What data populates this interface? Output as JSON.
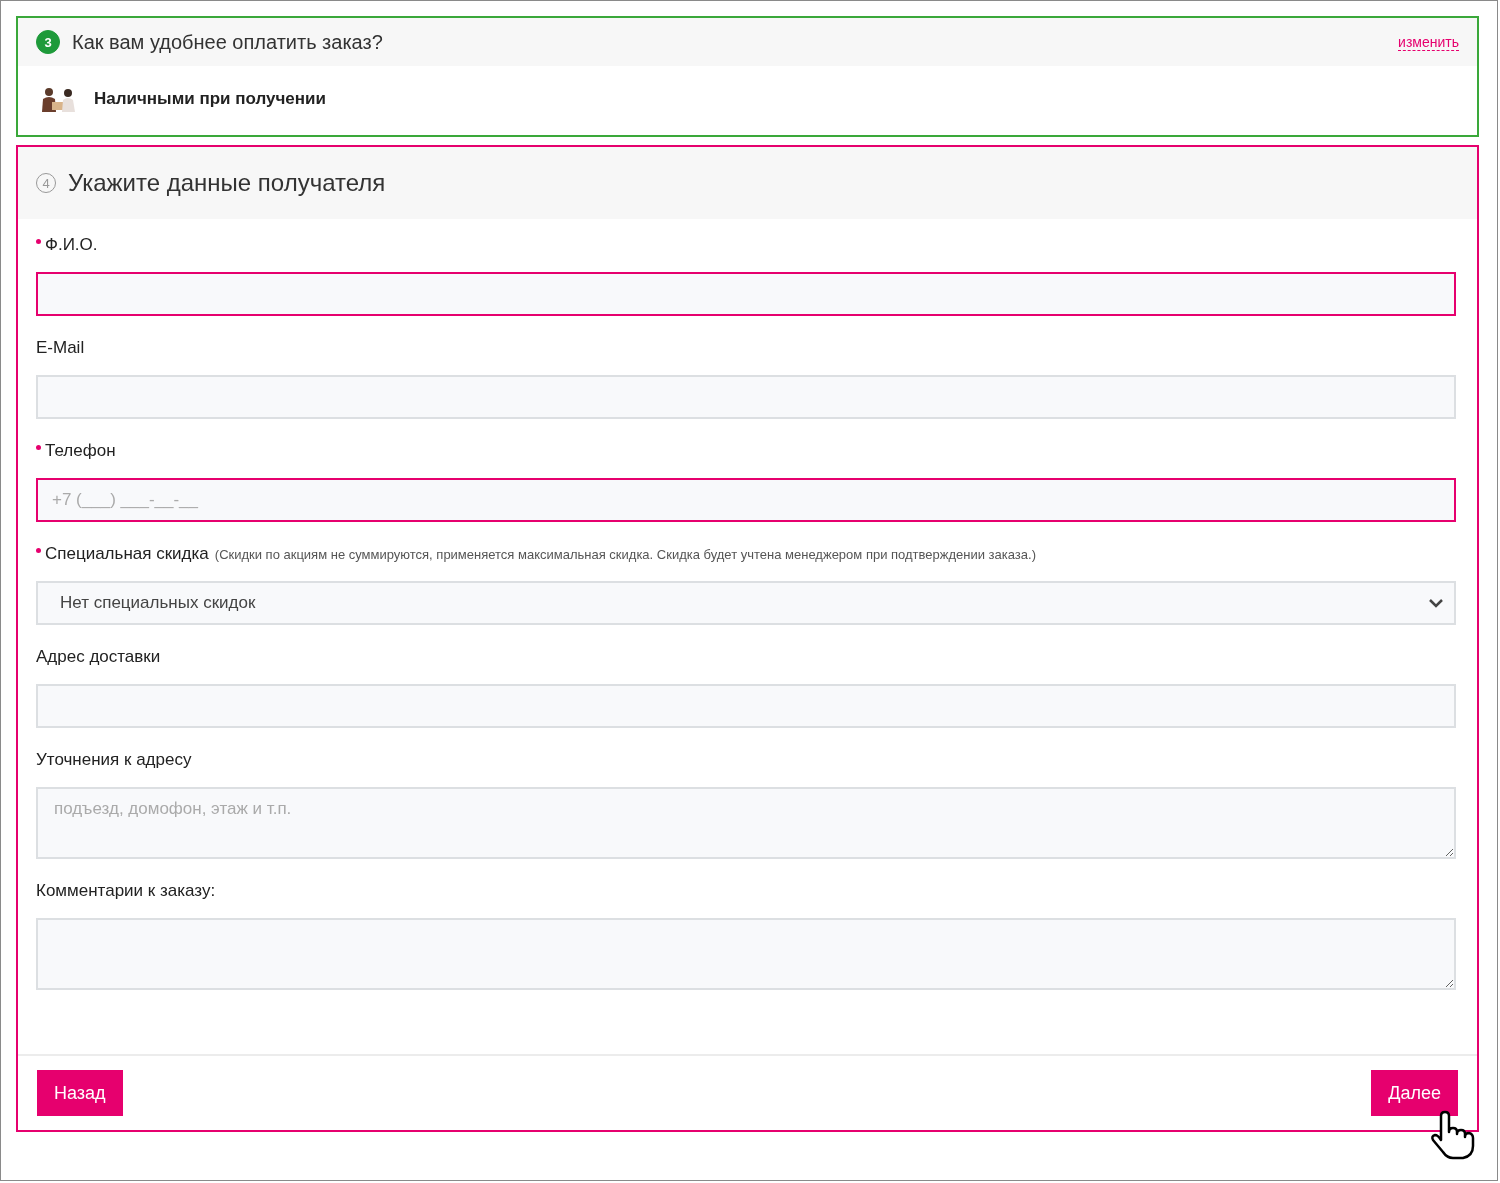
{
  "payment_section": {
    "step": "3",
    "completed": true,
    "title": "Как вам удобнее оплатить заказ?",
    "change_link": "изменить",
    "method": "Наличными при получении"
  },
  "recipient_section": {
    "step": "4",
    "completed": false,
    "title": "Укажите данные получателя",
    "fields": [
      {
        "kind": "input",
        "label": "Ф.И.О.",
        "required": true,
        "error": true
      },
      {
        "kind": "input",
        "label": "E-Mail",
        "required": false,
        "error": false
      },
      {
        "kind": "input",
        "label": "Телефон",
        "required": true,
        "error": true,
        "placeholder": "+7 (___) ___-__-__"
      },
      {
        "kind": "select",
        "label": "Специальная скидка",
        "hint": "(Скидки по акциям не суммируются, применяется максимальная скидка. Скидка будет учтена менеджером при подтверждении заказа.)",
        "required": true,
        "error": false,
        "value": "Нет специальных скидок"
      },
      {
        "kind": "input",
        "label": "Адрес доставки",
        "required": false,
        "error": false
      },
      {
        "kind": "textarea",
        "label": "Уточнения к адресу",
        "required": false,
        "error": false,
        "placeholder": "подъезд, домофон, этаж и т.п."
      },
      {
        "kind": "textarea",
        "label": "Комментарии к заказу:",
        "required": false,
        "error": false
      }
    ],
    "buttons": [
      "Назад",
      "Далее"
    ]
  }
}
